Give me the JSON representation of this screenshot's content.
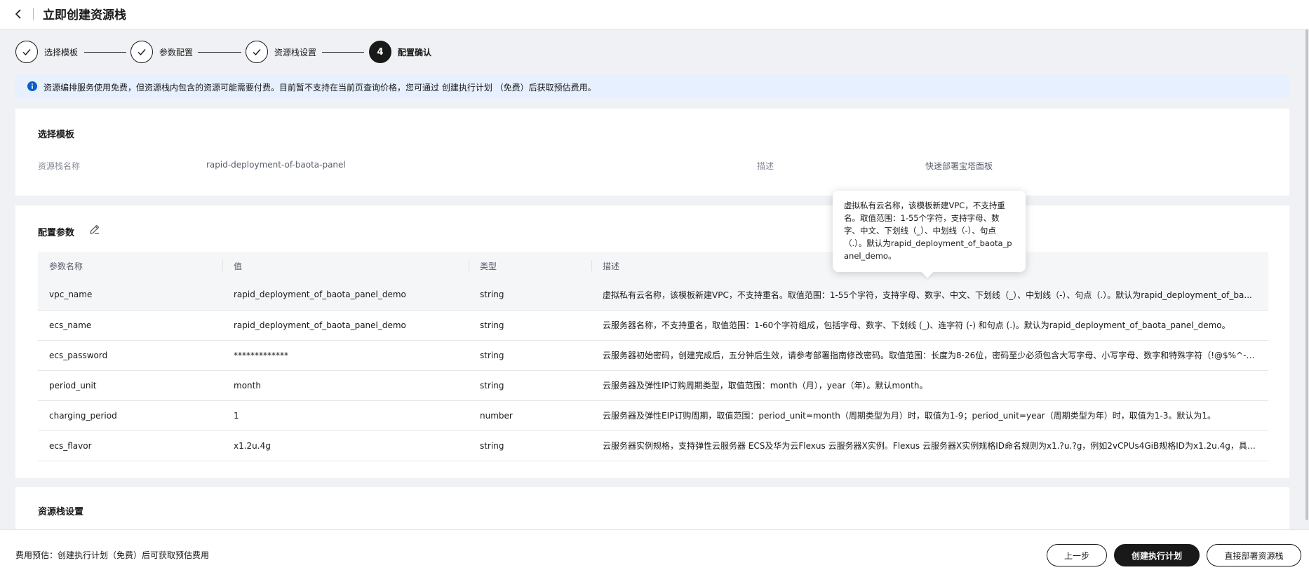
{
  "header": {
    "title": "立即创建资源栈",
    "back_icon": "chevron-left-icon"
  },
  "steps": [
    {
      "label": "选择模板",
      "state": "done"
    },
    {
      "label": "参数配置",
      "state": "done"
    },
    {
      "label": "资源栈设置",
      "state": "done"
    },
    {
      "label": "配置确认",
      "state": "active",
      "number": "4"
    }
  ],
  "info_bar": {
    "icon": "info-icon",
    "text": "资源编排服务使用免费，但资源栈内包含的资源可能需要付费。目前暂不支持在当前页查询价格，您可通过 创建执行计划 （免费）后获取预估费用。"
  },
  "template_section": {
    "title": "选择模板",
    "stack_name_label": "资源栈名称",
    "stack_name_value": "rapid-deployment-of-baota-panel",
    "desc_label": "描述",
    "desc_value": "快速部署宝塔面板"
  },
  "params_section": {
    "title": "配置参数",
    "edit_icon": "edit-icon",
    "columns": [
      "参数名称",
      "值",
      "类型",
      "描述"
    ],
    "rows": [
      {
        "name": "vpc_name",
        "value": "rapid_deployment_of_baota_panel_demo",
        "type": "string",
        "desc": "虚拟私有云名称，该模板新建VPC，不支持重名。取值范围：1-55个字符，支持字母、数字、中文、下划线（_）、中划线（-）、句点（.）。默认为rapid_deployment_of_ba..."
      },
      {
        "name": "ecs_name",
        "value": "rapid_deployment_of_baota_panel_demo",
        "type": "string",
        "desc": "云服务器名称，不支持重名，取值范围：1-60个字符组成，包括字母、数字、下划线 (_)、连字符 (-) 和句点 (.)。默认为rapid_deployment_of_baota_panel_demo。"
      },
      {
        "name": "ecs_password",
        "value": "*************",
        "type": "string",
        "desc": "云服务器初始密码，创建完成后，五分钟后生效，请参考部署指南修改密码。取值范围：长度为8-26位，密码至少必须包含大写字母、小写字母、数字和特殊字符（!@$%^-_..."
      },
      {
        "name": "period_unit",
        "value": "month",
        "type": "string",
        "desc": "云服务器及弹性IP订购周期类型，取值范围：month（月），year（年）。默认month。"
      },
      {
        "name": "charging_period",
        "value": "1",
        "type": "number",
        "desc": "云服务器及弹性EIP订购周期，取值范围：period_unit=month（周期类型为月）时，取值为1-9；period_unit=year（周期类型为年）时，取值为1-3。默认为1。"
      },
      {
        "name": "ecs_flavor",
        "value": "x1.2u.4g",
        "type": "string",
        "desc": "云服务器实例规格，支持弹性云服务器 ECS及华为云Flexus 云服务器X实例。Flexus 云服务器X实例规格ID命名规则为x1.?u.?g，例如2vCPUs4GiB规格ID为x1.2u.4g，具体..."
      }
    ]
  },
  "tooltip": {
    "text": "虚拟私有云名称，该模板新建VPC，不支持重名。取值范围：1-55个字符，支持字母、数字、中文、下划线（_）、中划线（-）、句点（.）。默认为rapid_deployment_of_baota_panel_demo。"
  },
  "stack_settings_section": {
    "title": "资源栈设置"
  },
  "footer": {
    "cost_text": "费用预估：创建执行计划（免费）后可获取预估费用",
    "prev_label": "上一步",
    "create_plan_label": "创建执行计划",
    "deploy_label": "直接部署资源栈"
  }
}
